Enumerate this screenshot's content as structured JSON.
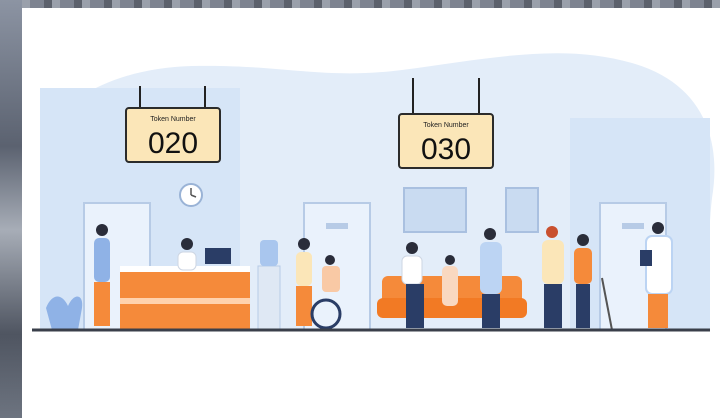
{
  "signs": [
    {
      "caption": "Token Number",
      "number": "020"
    },
    {
      "caption": "Token Number",
      "number": "030"
    }
  ],
  "colors": {
    "room_blob": "#e3edf9",
    "wall_panel": "#cfe0f5",
    "sign_fill": "#fbe6b8",
    "sign_stroke": "#2b2b2b",
    "desk": "#f58a3a",
    "sofa": "#f58a3a",
    "floor": "#3a3f4a"
  }
}
